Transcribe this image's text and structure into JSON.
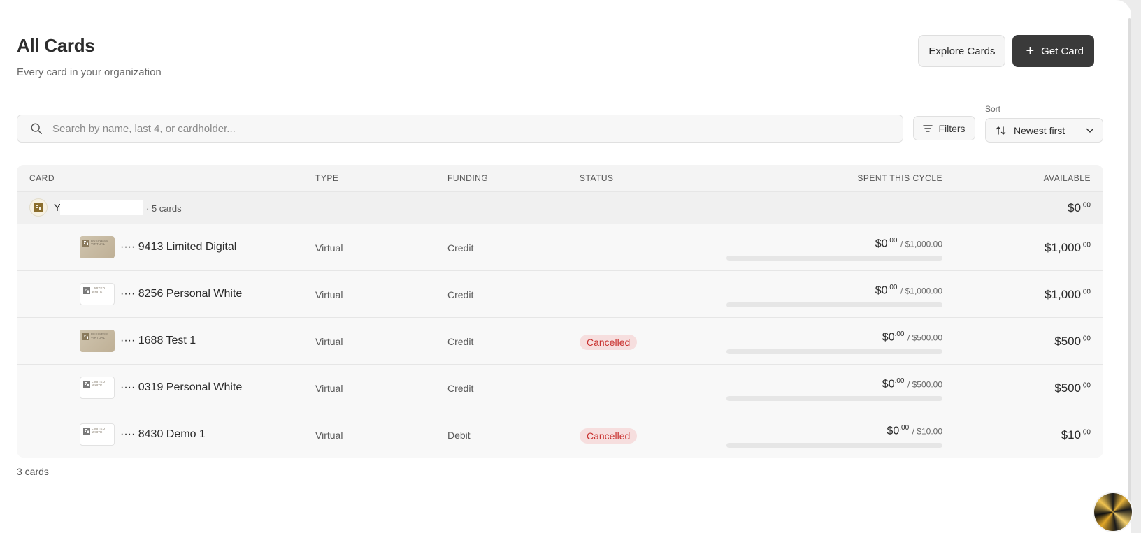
{
  "header": {
    "title": "All Cards",
    "subtitle": "Every card in your organization",
    "explore_label": "Explore Cards",
    "get_card_label": "Get Card"
  },
  "search": {
    "placeholder": "Search by name, last 4, or cardholder...",
    "value": ""
  },
  "filters": {
    "label": "Filters"
  },
  "sort": {
    "label": "Sort",
    "selected": "Newest first"
  },
  "table": {
    "columns": {
      "card": "CARD",
      "type": "TYPE",
      "funding": "FUNDING",
      "status": "STATUS",
      "spent": "SPENT THIS CYCLE",
      "available": "AVAILABLE"
    },
    "group": {
      "name_initial": "Y",
      "count": "· 5 cards",
      "available_main": "$0",
      "available_cents": ".00"
    },
    "rows": [
      {
        "thumb": "gold",
        "thumb_text": "BUSINESS VIRTUAL",
        "name": "···· 9413 Limited Digital",
        "type": "Virtual",
        "funding": "Credit",
        "status": "",
        "spent_main": "$0",
        "spent_cents": ".00",
        "limit": "/ $1,000.00",
        "available_main": "$1,000",
        "available_cents": ".00",
        "progress": 0
      },
      {
        "thumb": "white",
        "thumb_text": "LIMITED WHITE",
        "name": "···· 8256 Personal White",
        "type": "Virtual",
        "funding": "Credit",
        "status": "",
        "spent_main": "$0",
        "spent_cents": ".00",
        "limit": "/ $1,000.00",
        "available_main": "$1,000",
        "available_cents": ".00",
        "progress": 0
      },
      {
        "thumb": "gold",
        "thumb_text": "BUSINESS VIRTUAL",
        "name": "···· 1688 Test 1",
        "type": "Virtual",
        "funding": "Credit",
        "status": "Cancelled",
        "spent_main": "$0",
        "spent_cents": ".00",
        "limit": "/ $500.00",
        "available_main": "$500",
        "available_cents": ".00",
        "progress": 0
      },
      {
        "thumb": "white",
        "thumb_text": "LIMITED WHITE",
        "name": "···· 0319 Personal White",
        "type": "Virtual",
        "funding": "Credit",
        "status": "",
        "spent_main": "$0",
        "spent_cents": ".00",
        "limit": "/ $500.00",
        "available_main": "$500",
        "available_cents": ".00",
        "progress": 0
      },
      {
        "thumb": "white",
        "thumb_text": "LIMITED WHITE",
        "name": "···· 8430 Demo 1",
        "type": "Virtual",
        "funding": "Debit",
        "status": "Cancelled",
        "spent_main": "$0",
        "spent_cents": ".00",
        "limit": "/ $10.00",
        "available_main": "$10",
        "available_cents": ".00",
        "progress": 0
      }
    ]
  },
  "footer": {
    "count": "3 cards"
  },
  "colors": {
    "primary_button": "#3a3a3a",
    "status_cancelled_text": "#c9312f",
    "status_cancelled_bg": "#f6dede",
    "card_gold": "#cfc4ae"
  },
  "icons": {
    "search": "search-icon",
    "filters": "filter-lines-icon",
    "sort": "sort-arrows-icon",
    "chevron": "chevron-down-icon",
    "plus": "plus-icon",
    "help": "help-orb-icon"
  }
}
